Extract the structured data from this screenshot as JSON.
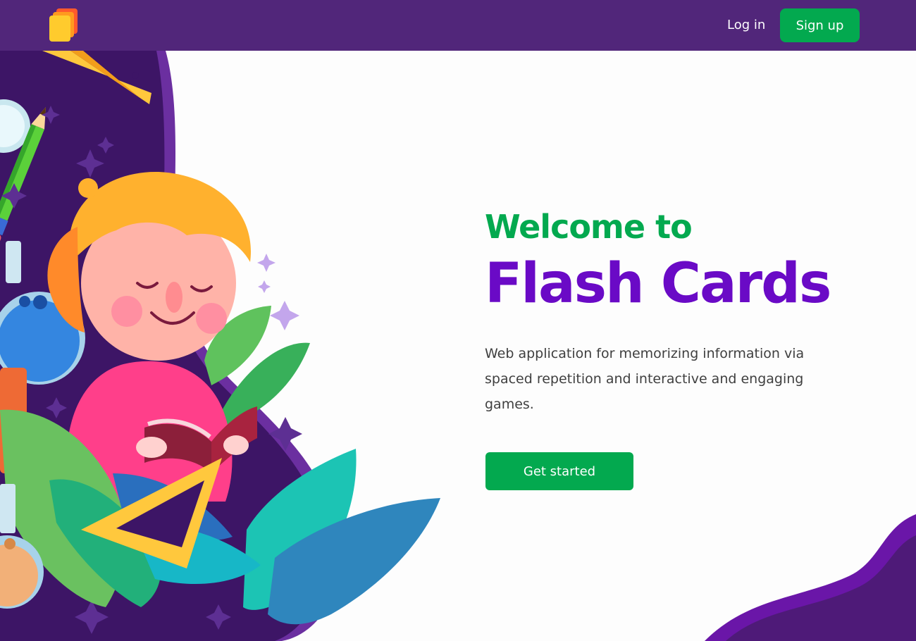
{
  "brand": {
    "logo_icon": "stacked-cards-icon"
  },
  "nav": {
    "login_label": "Log in",
    "signup_label": "Sign up"
  },
  "hero": {
    "welcome": "Welcome to",
    "title": "Flash Cards",
    "description": "Web application for memorizing information via spaced repetition and interactive and engaging games.",
    "cta_label": "Get started"
  },
  "colors": {
    "nav_bg": "#51267a",
    "accent_green": "#03a94f",
    "title_purple": "#6a0ac6",
    "text_gray": "#3f3f3f",
    "page_bg": "#fdfdfd"
  },
  "illustration": {
    "subject": "child-reading-book-illustration"
  }
}
